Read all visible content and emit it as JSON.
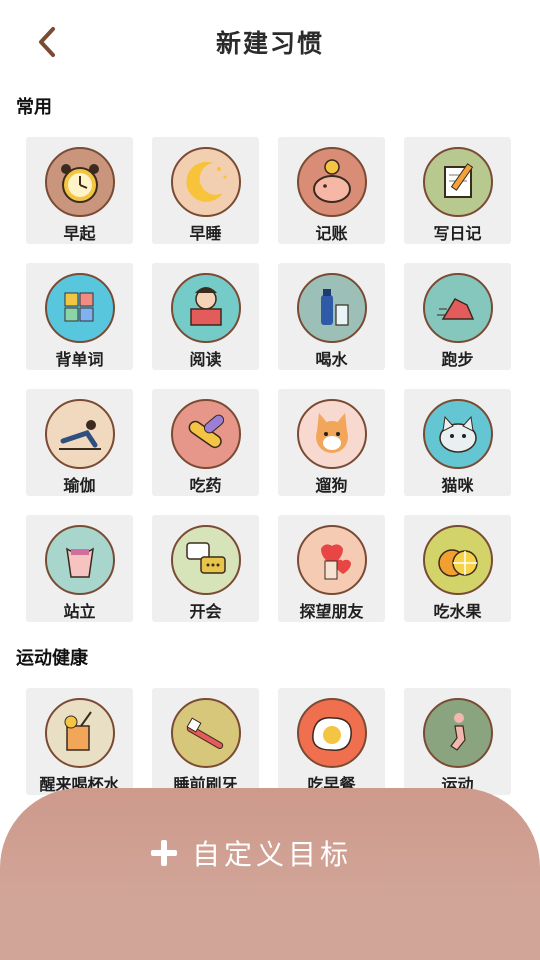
{
  "header": {
    "title": "新建习惯"
  },
  "sections": [
    {
      "title": "常用",
      "items": [
        {
          "label": "早起",
          "icon": "alarm-clock-icon",
          "bg": "#c9957d"
        },
        {
          "label": "早睡",
          "icon": "moon-icon",
          "bg": "#f2cfb0"
        },
        {
          "label": "记账",
          "icon": "piggy-bank-icon",
          "bg": "#d98c76"
        },
        {
          "label": "写日记",
          "icon": "notebook-pencil-icon",
          "bg": "#b7c98f"
        },
        {
          "label": "背单词",
          "icon": "abc-blocks-icon",
          "bg": "#58c6dd"
        },
        {
          "label": "阅读",
          "icon": "reading-person-icon",
          "bg": "#74cbc7"
        },
        {
          "label": "喝水",
          "icon": "water-bottle-icon",
          "bg": "#9cc0b7"
        },
        {
          "label": "跑步",
          "icon": "running-shoe-icon",
          "bg": "#85c7bd"
        },
        {
          "label": "瑜伽",
          "icon": "yoga-icon",
          "bg": "#f0d9bf"
        },
        {
          "label": "吃药",
          "icon": "pill-icon",
          "bg": "#e7978a"
        },
        {
          "label": "遛狗",
          "icon": "dog-icon",
          "bg": "#f7d9cf"
        },
        {
          "label": "猫咪",
          "icon": "cat-icon",
          "bg": "#63c6d2"
        },
        {
          "label": "站立",
          "icon": "standing-body-icon",
          "bg": "#a8d5cc"
        },
        {
          "label": "开会",
          "icon": "chat-bubbles-icon",
          "bg": "#d7e3b9"
        },
        {
          "label": "探望朋友",
          "icon": "heart-balloon-icon",
          "bg": "#f6cbb3"
        },
        {
          "label": "吃水果",
          "icon": "citrus-fruit-icon",
          "bg": "#d2d46a"
        }
      ]
    },
    {
      "title": "运动健康",
      "items": [
        {
          "label": "醒来喝杯水",
          "icon": "drink-cup-icon",
          "bg": "#e8dfc4"
        },
        {
          "label": "睡前刷牙",
          "icon": "toothbrush-icon",
          "bg": "#d7c77a"
        },
        {
          "label": "吃早餐",
          "icon": "fried-egg-icon",
          "bg": "#ef6f4e"
        },
        {
          "label": "运动",
          "icon": "exercise-person-icon",
          "bg": "#8aa47f"
        }
      ]
    }
  ],
  "custom_goal": {
    "label": "自定义目标"
  },
  "colors": {
    "sheet": "#d1a699",
    "tile": "#efefef",
    "accent_border": "#7a4b34"
  }
}
